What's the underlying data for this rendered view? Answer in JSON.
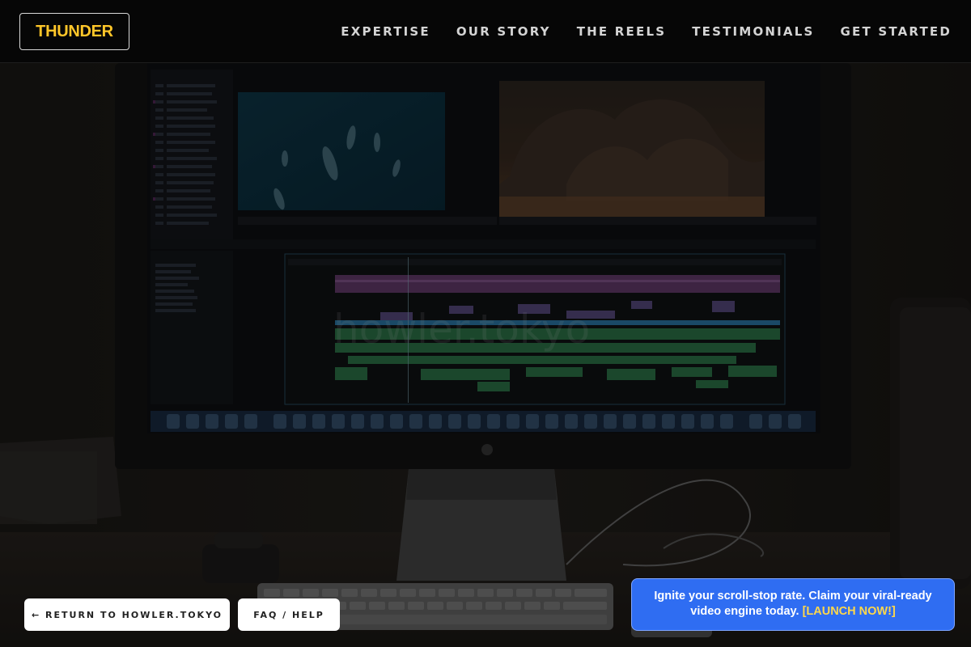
{
  "header": {
    "logo": "THUNDER",
    "nav": [
      {
        "label": "EXPERTISE"
      },
      {
        "label": "OUR STORY"
      },
      {
        "label": "THE REELS"
      },
      {
        "label": "TESTIMONIALS"
      },
      {
        "label": "GET STARTED"
      }
    ]
  },
  "hero": {
    "watermark": "howler.tokyo",
    "image_subject": "video editing timeline on desktop monitor"
  },
  "footer": {
    "return_label": "← RETURN TO HOWLER.TOKYO",
    "faq_label": "FAQ / HELP"
  },
  "cta": {
    "text": "Ignite your scroll-stop rate. Claim your viral-ready video engine today.",
    "link": "[LAUNCH NOW!]"
  },
  "colors": {
    "accent": "#ffc629",
    "cta_bg": "#2f6df2",
    "cta_link": "#ffd84a"
  }
}
